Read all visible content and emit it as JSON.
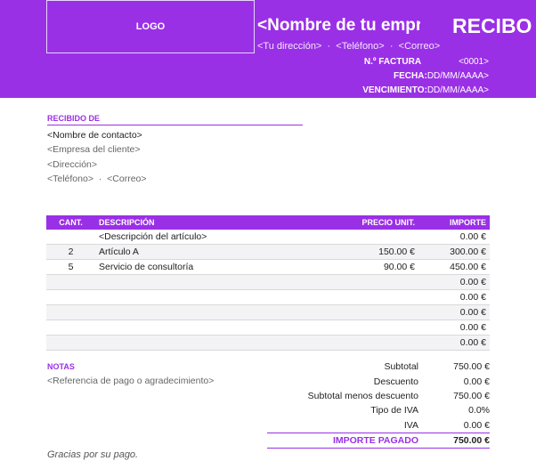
{
  "header": {
    "logo_text": "LOGO",
    "company_name": "<Nombre de tu empresa>",
    "doc_title": "RECIBO",
    "address": "<Tu dirección>",
    "phone": "<Teléfono>",
    "email": "<Correo>",
    "separator": "·",
    "invoice_label": "N.º FACTURA",
    "invoice_value": "<0001>",
    "date_label": "FECHA:",
    "date_value": "DD/MM/AAAA>",
    "due_label": "VENCIMIENTO:",
    "due_value": "DD/MM/AAAA>"
  },
  "client": {
    "heading": "RECIBIDO DE",
    "contact_name": "<Nombre de contacto>",
    "company": "<Empresa del cliente>",
    "address": "<Dirección>",
    "phone": "<Teléfono>",
    "email": "<Correo>",
    "separator": "·"
  },
  "items_table": {
    "columns": {
      "qty": "CANT.",
      "description": "DESCRIPCIÓN",
      "unit_price": "PRECIO UNIT.",
      "amount": "IMPORTE"
    },
    "rows": [
      {
        "qty": "",
        "description": "<Descripción del artículo>",
        "unit_price": "",
        "amount": "0.00 €"
      },
      {
        "qty": "2",
        "description": "Artículo A",
        "unit_price": "150.00 €",
        "amount": "300.00 €"
      },
      {
        "qty": "5",
        "description": "Servicio de consultoría",
        "unit_price": "90.00 €",
        "amount": "450.00 €"
      },
      {
        "qty": "",
        "description": "",
        "unit_price": "",
        "amount": "0.00 €"
      },
      {
        "qty": "",
        "description": "",
        "unit_price": "",
        "amount": "0.00 €"
      },
      {
        "qty": "",
        "description": "",
        "unit_price": "",
        "amount": "0.00 €"
      },
      {
        "qty": "",
        "description": "",
        "unit_price": "",
        "amount": "0.00 €"
      },
      {
        "qty": "",
        "description": "",
        "unit_price": "",
        "amount": "0.00 €"
      }
    ]
  },
  "notes": {
    "heading": "NOTAS",
    "text": "<Referencia de pago o agradecimiento>"
  },
  "totals": {
    "subtotal_label": "Subtotal",
    "subtotal_value": "750.00 €",
    "discount_label": "Descuento",
    "discount_value": "0.00 €",
    "subtotal_less_label": "Subtotal menos descuento",
    "subtotal_less_value": "750.00 €",
    "tax_rate_label": "Tipo de IVA",
    "tax_rate_value": "0.0%",
    "tax_label": "IVA",
    "tax_value": "0.00 €",
    "paid_label": "IMPORTE PAGADO",
    "paid_value": "750.00 €"
  },
  "footer": {
    "thanks": "Gracias por su pago."
  },
  "colors": {
    "accent": "#9a30e6"
  }
}
